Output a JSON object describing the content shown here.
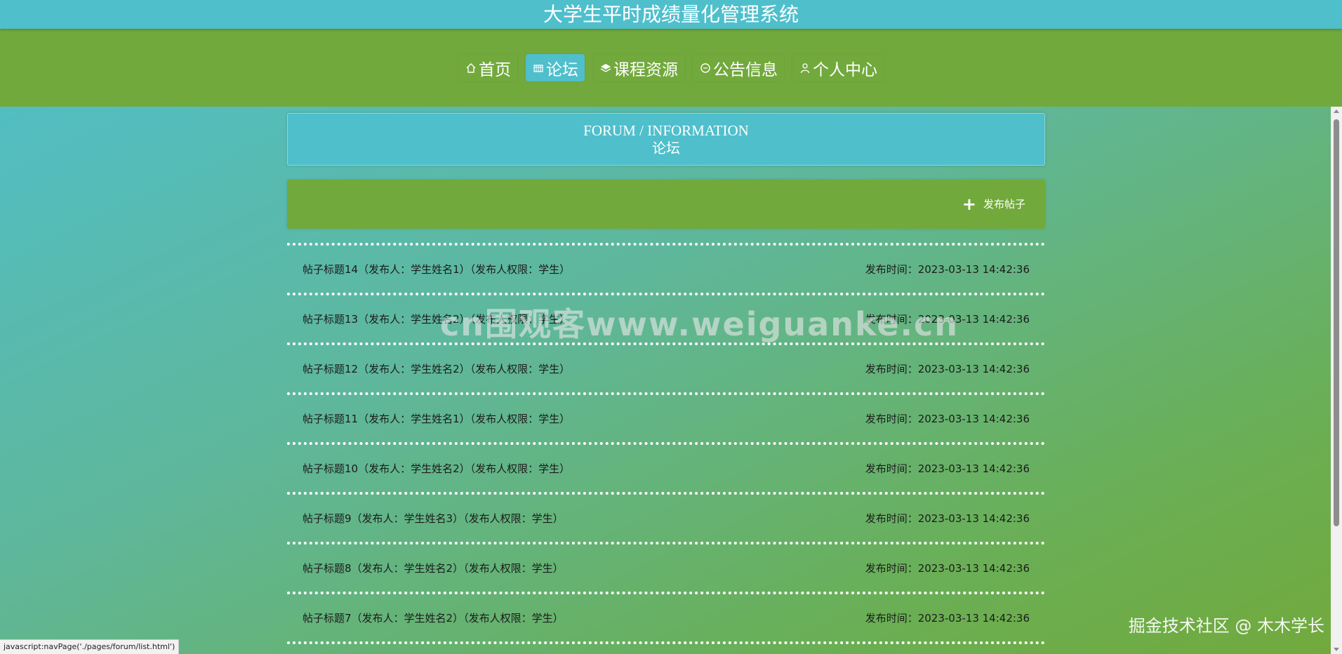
{
  "header": {
    "site_title": "大学生平时成绩量化管理系统"
  },
  "nav": {
    "items": [
      {
        "label": "首页",
        "icon": "home-icon",
        "active": false
      },
      {
        "label": "论坛",
        "icon": "forum-icon",
        "active": true
      },
      {
        "label": "课程资源",
        "icon": "layers-icon",
        "active": false
      },
      {
        "label": "公告信息",
        "icon": "notice-icon",
        "active": false
      },
      {
        "label": "个人中心",
        "icon": "user-icon",
        "active": false
      }
    ]
  },
  "page_header": {
    "en": "FORUM / INFORMATION",
    "cn": "论坛"
  },
  "actions": {
    "publish_label": "发布帖子",
    "publish_icon": "plus-icon"
  },
  "posts": [
    {
      "title": "帖子标题14（发布人：学生姓名1）（发布人权限：学生）",
      "time": "发布时间：2023-03-13 14:42:36"
    },
    {
      "title": "帖子标题13（发布人：学生姓名2）（发布人权限：学生）",
      "time": "发布时间：2023-03-13 14:42:36"
    },
    {
      "title": "帖子标题12（发布人：学生姓名2）（发布人权限：学生）",
      "time": "发布时间：2023-03-13 14:42:36"
    },
    {
      "title": "帖子标题11（发布人：学生姓名1）（发布人权限：学生）",
      "time": "发布时间：2023-03-13 14:42:36"
    },
    {
      "title": "帖子标题10（发布人：学生姓名2）（发布人权限：学生）",
      "time": "发布时间：2023-03-13 14:42:36"
    },
    {
      "title": "帖子标题9（发布人：学生姓名3）（发布人权限：学生）",
      "time": "发布时间：2023-03-13 14:42:36"
    },
    {
      "title": "帖子标题8（发布人：学生姓名2）（发布人权限：学生）",
      "time": "发布时间：2023-03-13 14:42:36"
    },
    {
      "title": "帖子标题7（发布人：学生姓名2）（发布人权限：学生）",
      "time": "发布时间：2023-03-13 14:42:36"
    }
  ],
  "status_bar": {
    "url": "javascript:navPage('./pages/forum/list.html')"
  },
  "watermarks": {
    "center": "cn围观客www.weiguanke.cn",
    "bottom_right": "掘金技术社区 @ 木木学长"
  },
  "colors": {
    "title_bar": "#4fbfcc",
    "nav_band": "#72a93c",
    "active_tab": "#4fbfcc"
  }
}
